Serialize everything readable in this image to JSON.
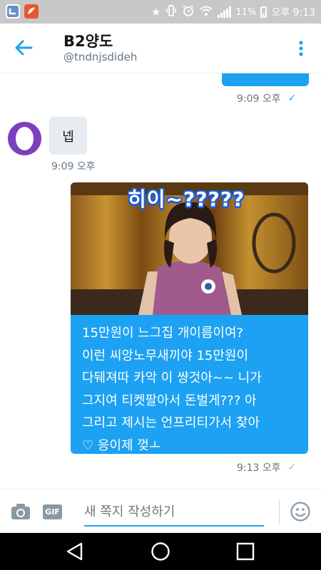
{
  "status_bar": {
    "battery_percent": "11%",
    "time": "오후 9:13",
    "icons": [
      "notification-app-icon",
      "notification-app2-icon",
      "star-icon",
      "vibrate-icon",
      "alarm-icon",
      "wifi-icon",
      "signal-icon",
      "battery-icon"
    ]
  },
  "header": {
    "name": "B2양도",
    "handle": "@tndnjsdideh",
    "back_icon": "back-arrow-icon",
    "menu_icon": "more-vertical-icon"
  },
  "messages": [
    {
      "direction": "outgoing",
      "partial": true,
      "time": "9:09 오후",
      "status": "sent-check"
    },
    {
      "direction": "incoming",
      "text": "넵",
      "time": "9:09 오후"
    },
    {
      "direction": "outgoing",
      "type": "image",
      "caption": "히이~?????"
    },
    {
      "direction": "outgoing",
      "text": "15만원이 느그집 개이름이여?\n이런 씨앙노무새끼야 15만원이\n다뒈져따 카악 이 썅것아~~ 니가\n그지여 티켓팔아서 돈벌게??? 아\n그리고 제시는 언프리티가서 찾아\n♡ 응이제 껒ㅗ",
      "time": "9:13 오후",
      "status": "sent-check"
    }
  ],
  "composer": {
    "placeholder": "새 쪽지 작성하기",
    "gif_label": "GIF",
    "camera_icon": "camera-icon",
    "emoji_icon": "emoji-icon"
  },
  "nav": {
    "back_icon": "nav-back-icon",
    "home_icon": "nav-home-icon",
    "recents_icon": "nav-recents-icon"
  },
  "colors": {
    "accent": "#1da1f2",
    "incoming_bubble": "#e6ecf0",
    "avatar": "#7b3fbf"
  }
}
